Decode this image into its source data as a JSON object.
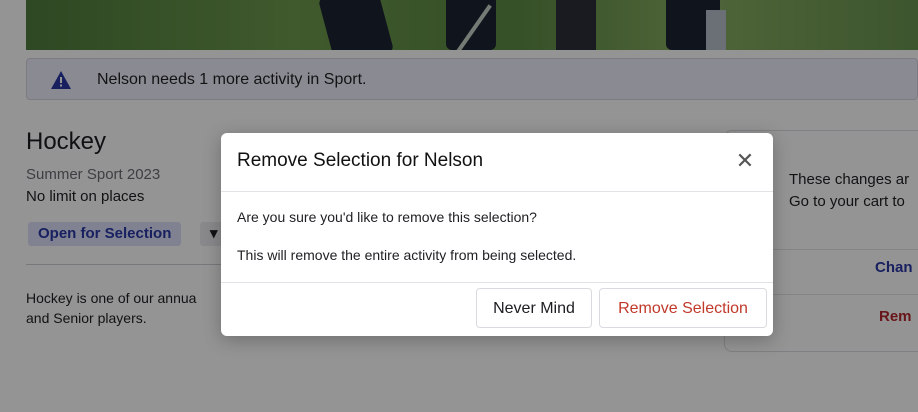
{
  "alert": {
    "icon": "warning-triangle-icon",
    "text": "Nelson needs 1 more activity in Sport."
  },
  "activity": {
    "title": "Hockey",
    "season": "Summer Sport 2023",
    "places": "No limit on places",
    "status": "Open for Selection",
    "description_line1": "Hockey is one of our annua",
    "description_line2": "and Senior players."
  },
  "side_card": {
    "note_line1": "These changes ar",
    "note_line2": "Go to your cart to",
    "change_label": "Chan",
    "remove_label": "Rem"
  },
  "modal": {
    "title": "Remove Selection for Nelson",
    "close_glyph": "✕",
    "body_line1": "Are you sure you'd like to remove this selection?",
    "body_line2": "This will remove the entire activity from being selected.",
    "never_mind_label": "Never Mind",
    "remove_label": "Remove Selection"
  },
  "colors": {
    "accent": "#2a37a6",
    "danger": "#c0392b",
    "warning": "#2a37a6"
  }
}
